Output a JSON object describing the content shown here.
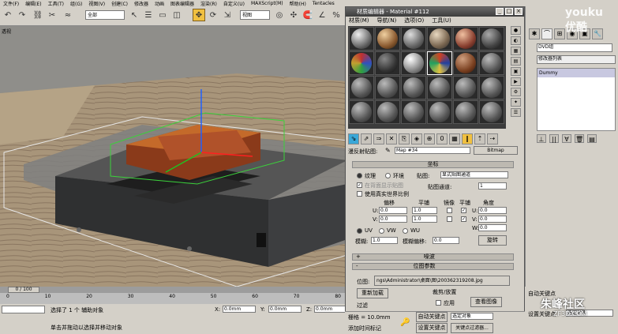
{
  "menubar": {
    "items": [
      "文件(F)",
      "编辑(E)",
      "工具(T)",
      "组(G)",
      "视图(V)",
      "创建(C)",
      "修改器",
      "动画",
      "图表编辑器",
      "渲染(R)",
      "自定义(U)",
      "MAXScript(M)",
      "帮助(H)",
      "Tentacles"
    ]
  },
  "toolbar": {
    "filter_label": "全部",
    "view_label": "视图"
  },
  "viewport": {
    "label": "透视"
  },
  "material_editor": {
    "title": "材质编辑器 - Material #112",
    "menu": [
      "材质(M)",
      "导航(N)",
      "选项(O)",
      "工具(U)"
    ],
    "map_type_label": "漫反射贴图:",
    "map_name": "Map #34",
    "map_kind": "Bitmap",
    "coords": {
      "header": "坐标",
      "texture_label": "纹理",
      "environ_label": "环境",
      "mapping_label": "贴图:",
      "mapping_value": "显式贴图通道",
      "show_back_label": "在背面显示贴图",
      "map_channel_label": "贴图通道:",
      "map_channel_value": "1",
      "real_world_label": "使用真实世界比例",
      "offset_label": "偏移",
      "tiling_label": "平铺",
      "mirror_label": "镜像",
      "tile_label": "平铺",
      "angle_label": "角度",
      "u_label": "U:",
      "v_label": "V:",
      "w_label": "W:",
      "u_offset": "0.0",
      "v_offset": "0.0",
      "u_tiling": "1.0",
      "v_tiling": "1.0",
      "u_angle": "0.0",
      "v_angle": "0.0",
      "w_angle": "0.0",
      "uv_label": "UV",
      "vw_label": "VW",
      "wu_label": "WU",
      "blur_label": "模糊:",
      "blur_value": "1.0",
      "blur_offset_label": "模糊偏移:",
      "blur_offset_value": "0.0",
      "rotate_button": "旋转"
    },
    "noise_header": "噪波",
    "bitmap_params_header": "位图参数",
    "bitmap_label": "位图:",
    "bitmap_path": "ngs\\Administrator\\桌面\\图\\200362319208.jpg",
    "reload_button": "重新加载",
    "filter_label": "过滤",
    "crop_label": "裁剪/放置",
    "apply_label": "应用",
    "view_image_button": "查看图像"
  },
  "cmdpanel": {
    "object_name": "DVD组",
    "modifier_list": "修改器列表",
    "stack_item": "Dummy"
  },
  "timeline": {
    "frame": "0 / 100",
    "ticks": [
      "0",
      "10",
      "20",
      "30",
      "40",
      "50",
      "60",
      "70",
      "80"
    ]
  },
  "status": {
    "selection": "选择了 1 个 辅助对象",
    "prompt": "单击并拖动以选择并移动对象",
    "x_label": "X:",
    "x_value": "0.0mm",
    "y_label": "Y:",
    "y_value": "0.0mm",
    "z_label": "Z:",
    "z_value": "0.0mm",
    "grid": "栅格 = 10.0mm",
    "add_time_tag": "添加时间标记",
    "auto_key": "自动关键点",
    "set_key": "设置关键点",
    "selected_obj": "选定对象",
    "key_filters": "关键点过滤器..."
  },
  "watermark": {
    "site": "朱峰社区",
    "url": "ZF3D.COM",
    "logo_text": "youku 优酷"
  }
}
